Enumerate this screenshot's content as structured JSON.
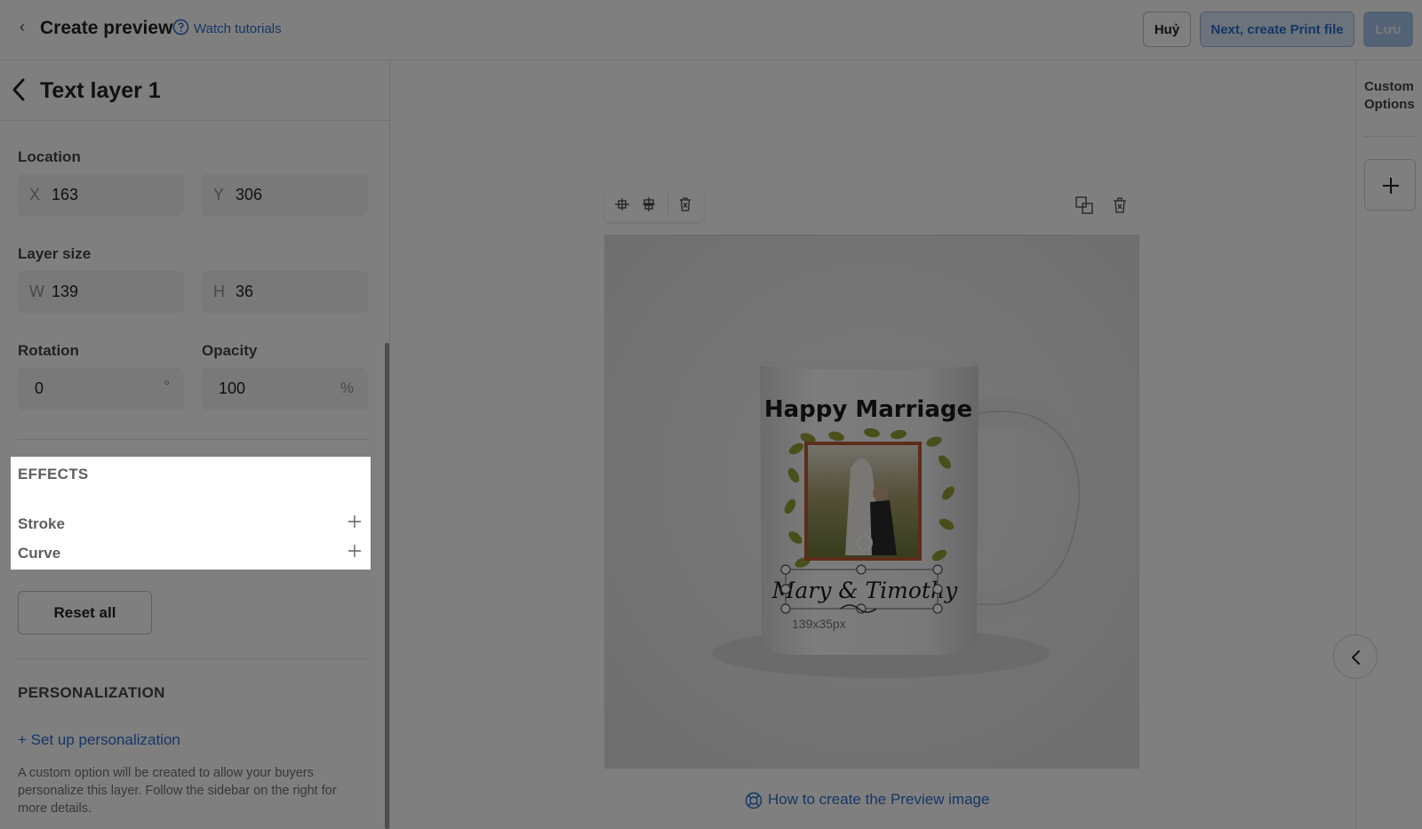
{
  "header": {
    "back_glyph": "‹",
    "title": "Create preview",
    "watch_label": "Watch tutorials",
    "cancel_label": "Huỷ",
    "next_label": "Next, create Print file",
    "save_label": "Lưu"
  },
  "layer": {
    "title": "Text layer 1",
    "location_label": "Location",
    "x_prefix": "X",
    "x_value": "163",
    "y_prefix": "Y",
    "y_value": "306",
    "size_label": "Layer size",
    "w_prefix": "W",
    "w_value": "139",
    "h_prefix": "H",
    "h_value": "36",
    "rotation_label": "Rotation",
    "rotation_value": "0",
    "rotation_unit": "°",
    "opacity_label": "Opacity",
    "opacity_value": "100",
    "opacity_unit": "%"
  },
  "effects": {
    "title": "EFFECTS",
    "stroke_label": "Stroke",
    "curve_label": "Curve"
  },
  "reset_label": "Reset all",
  "personalization": {
    "title": "PERSONALIZATION",
    "link_label": "+ Set up personalization",
    "description": "A custom option will be created to allow your buyers personalize this layer. Follow the sidebar on the right for more details."
  },
  "canvas": {
    "mug_title": "Happy Marriage",
    "mug_names": "Mary & Timothy",
    "size_readout": "139x35px",
    "help_link": "How to create the Preview image"
  },
  "right_panel": {
    "custom_options_label": "Custom Options"
  },
  "colors": {
    "accent": "#2c6ecb",
    "overlay": "rgba(0,0,0,0.5)"
  }
}
